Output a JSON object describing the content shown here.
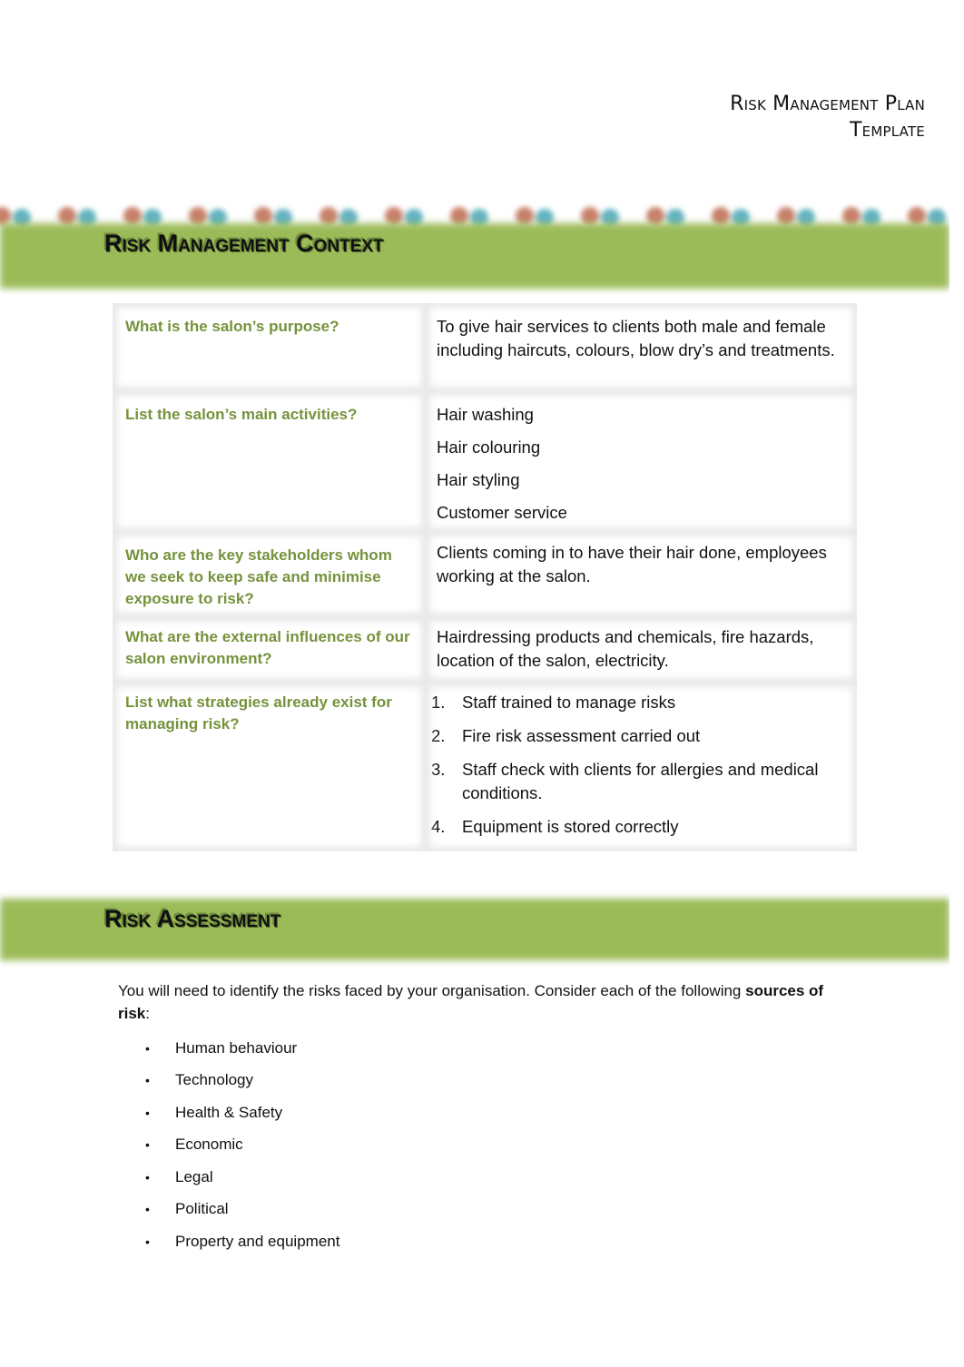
{
  "document": {
    "title_line1": "Risk Management Plan",
    "title_line2": "Template"
  },
  "brand": {
    "banner_green": "#9bbb59",
    "question_green": "#76923c"
  },
  "context_section": {
    "heading": "Risk Management Context",
    "rows": [
      {
        "question": "What is the salon’s purpose?",
        "answer": "To give hair services to clients both male and female including haircuts, colours, blow dry’s and treatments."
      },
      {
        "question": "List the salon’s main activities?",
        "activities": [
          "Hair washing",
          "Hair colouring",
          "Hair styling",
          "Customer service"
        ]
      },
      {
        "question": "Who are the key stakeholders whom we seek to keep safe and minimise exposure to risk?",
        "answer": "Clients coming in to have their hair done, employees working at the salon."
      },
      {
        "question": "What are the external influences of our salon environment?",
        "answer": "Hairdressing products and chemicals, fire hazards, location of the salon, electricity."
      },
      {
        "question": "List what strategies already exist for managing risk?",
        "strategies": [
          {
            "num": "1.",
            "text": "Staff trained to manage risks"
          },
          {
            "num": "2.",
            "text": "Fire risk assessment carried out"
          },
          {
            "num": "3.",
            "text": "Staff check with clients for allergies and medical conditions."
          },
          {
            "num": "4.",
            "text": "Equipment is stored correctly"
          }
        ]
      }
    ]
  },
  "assessment_section": {
    "heading": "Risk Assessment",
    "intro_text": "You will need to identify the risks faced by your organisation. Consider each of the following ",
    "intro_bold": "sources of risk",
    "intro_suffix": ":",
    "bullet_glyph": "•",
    "sources": [
      "Human behaviour",
      "Technology",
      "Health & Safety",
      "Economic",
      "Legal",
      "Political",
      "Property and equipment"
    ]
  }
}
